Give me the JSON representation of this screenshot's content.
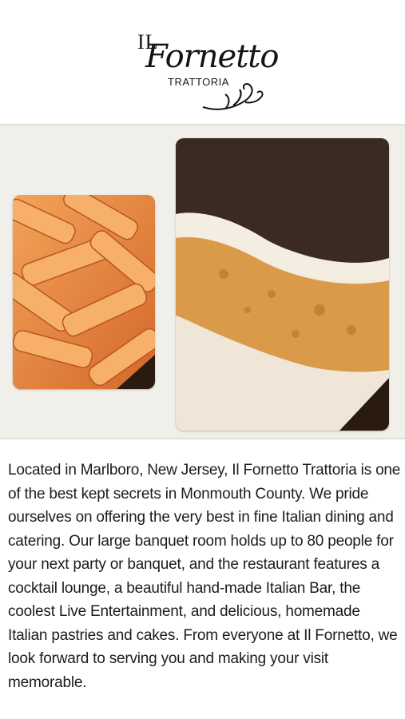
{
  "header": {
    "logo": {
      "il": "IL",
      "name": "Fornetto",
      "subtitle": "TRATTORIA",
      "brand_color": "#141414"
    }
  },
  "gallery": {
    "images": [
      {
        "name": "pasta-photo",
        "subject": "penne pasta in pink vodka sauce"
      },
      {
        "name": "tiramisu-photo",
        "subject": "tiramisu slice dusted with cocoa"
      }
    ],
    "background_color": "#f1efea"
  },
  "description": {
    "text": "Located in Marlboro, New Jersey, Il Fornetto Trattoria is one of the best kept secrets in Monmouth County. We pride ourselves on offering the very best in fine Italian dining and catering. Our large banquet room holds up to 80 people for your next party or banquet, and the restaurant features a cocktail lounge, a beautiful hand-made Italian Bar, the coolest Live Entertainment, and delicious, homemade Italian pastries and cakes. From everyone at Il Fornetto, we look forward to serving you and making your visit memorable."
  }
}
